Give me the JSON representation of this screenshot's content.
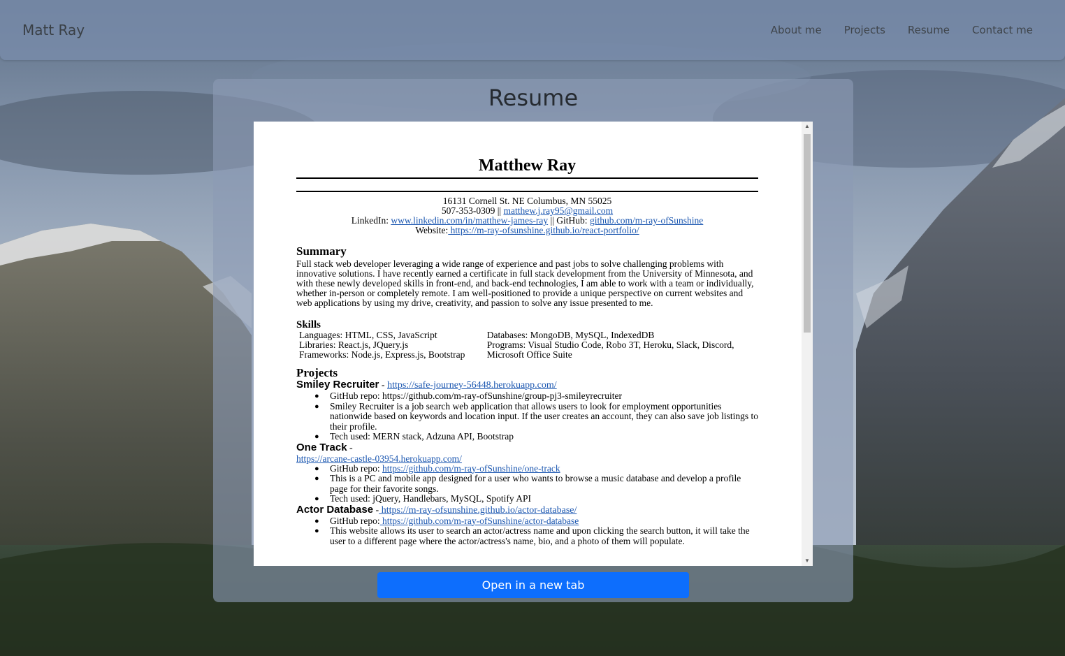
{
  "navbar": {
    "brand": "Matt Ray",
    "links": [
      "About me",
      "Projects",
      "Resume",
      "Contact me"
    ]
  },
  "page": {
    "title": "Resume",
    "open_button": "Open in a new tab"
  },
  "resume": {
    "name": "Matthew Ray",
    "address": "16131 Cornell St. NE Columbus, MN 55025",
    "phone": "507-353-0309 ||",
    "email": "matthew.j.ray95@gmail.com",
    "linkedin_label": "LinkedIn:",
    "linkedin_url": "www.linkedin.com/in/matthew-james-ray",
    "github_sep": "|| GitHub:",
    "github_url": "github.com/m-ray-ofSunshine",
    "website_label": "Website:",
    "website_url": " https://m-ray-ofsunshine.github.io/react-portfolio/",
    "summary_heading": "Summary",
    "summary": "Full stack web developer leveraging a wide range of experience and past jobs to solve challenging problems with innovative solutions. I have recently earned a certificate in full stack development from the University of Minnesota, and with these newly developed skills in front-end, and back-end technologies, I am able to work with a team or individually, whether in-person or completely remote. I am well-positioned to provide a unique perspective on current websites and web applications by using my drive, creativity, and passion to solve any issue presented to me.",
    "skills_heading": "Skills",
    "skills_col1": [
      "Languages: HTML, CSS, JavaScript",
      "Libraries: React.js, JQuery.js",
      "Frameworks: Node.js, Express.js, Bootstrap"
    ],
    "skills_col2": [
      "Databases: MongoDB, MySQL, IndexedDB",
      "Programs: Visual Studio Code, Robo 3T, Heroku, Slack, Discord, Microsoft Office Suite"
    ],
    "projects_heading": "Projects",
    "projects": [
      {
        "title": "Smiley Recruiter",
        "sep": " - ",
        "url": "https://safe-journey-56448.herokuapp.com/",
        "bullets": [
          "GitHub repo: https://github.com/m-ray-ofSunshine/group-pj3-smileyrecruiter",
          "Smiley Recruiter is a job search web application that allows users to look for employment opportunities nationwide based on keywords and location input. If the user creates an account, they can also save job listings to their profile.",
          "Tech used: MERN stack, Adzuna API, Bootstrap"
        ]
      },
      {
        "title": "One Track",
        "sep": " -",
        "url": "https://arcane-castle-03954.herokuapp.com/",
        "repo_label": "GitHub repo: ",
        "repo_url": "https://github.com/m-ray-ofSunshine/one-track",
        "bullets": [
          "This is a PC and mobile app designed for a user who wants to browse a music database and develop a profile page for their favorite songs.",
          "Tech used: jQuery, Handlebars, MySQL, Spotify API"
        ]
      },
      {
        "title": "Actor Database",
        "sep": " -",
        "url": " https://m-ray-ofsunshine.github.io/actor-database/",
        "repo_label": "GitHub repo:",
        "repo_url": " https://github.com/m-ray-ofSunshine/actor-database",
        "bullets": [
          "This website allows its user to search an actor/actress name and upon clicking the search button, it will take the user to a different page where the actor/actress's name, bio, and a photo of them will populate."
        ]
      }
    ]
  }
}
